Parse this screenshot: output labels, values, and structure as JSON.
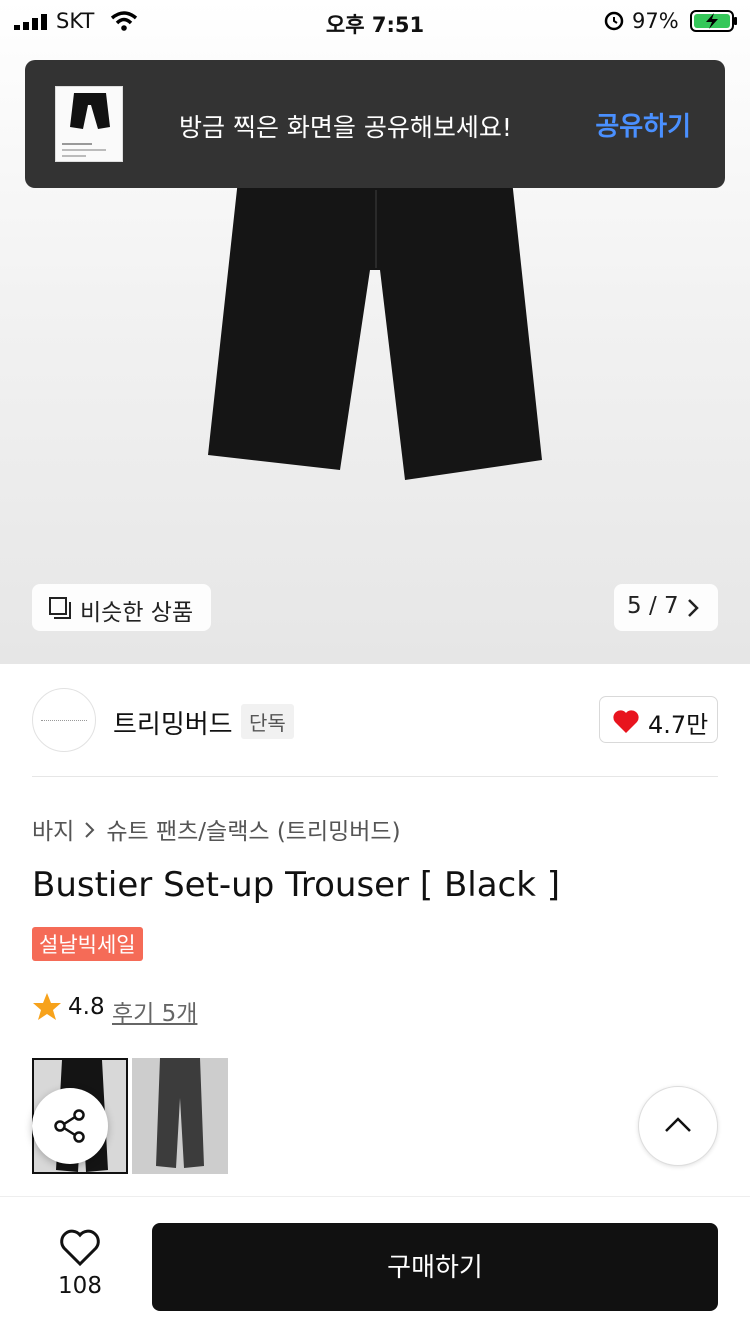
{
  "status_bar": {
    "carrier": "SKT",
    "time": "오후 7:51",
    "battery": "97%"
  },
  "toast": {
    "message": "방금 찍은 화면을 공유해보세요!",
    "action": "공유하기"
  },
  "gallery": {
    "similar_label": "비슷한 상품",
    "page_indicator": "5 / 7"
  },
  "brand": {
    "name": "트리밍버드",
    "exclusive_badge": "단독",
    "likes": "4.7만"
  },
  "breadcrumb": {
    "category": "바지",
    "subcategory": "슈트 팬츠/슬랙스 (트리밍버드)"
  },
  "product": {
    "title": "Bustier Set-up Trouser [ Black ]",
    "sale_badge": "설날빅세일",
    "rating": "4.8",
    "reviews": "후기 5개"
  },
  "bottom_bar": {
    "wish_count": "108",
    "buy_label": "구매하기"
  },
  "colors": {
    "accent_blue": "#4a90ff",
    "sale_red": "#f56b57",
    "heart_red": "#e8141e",
    "star_orange": "#f7a21b"
  }
}
